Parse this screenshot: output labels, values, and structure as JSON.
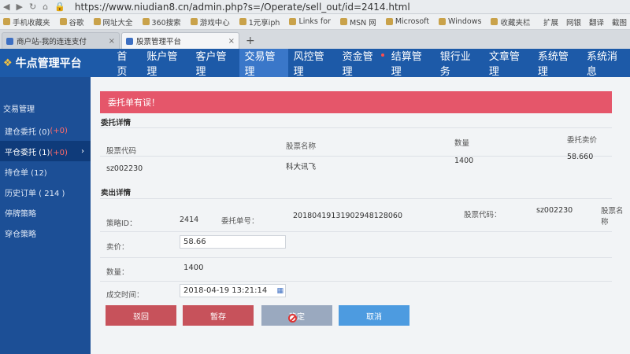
{
  "browser": {
    "url": "https://www.niudian8.cn/admin.php?s=/Operate/sell_out/id=2414.html",
    "bookmarks": [
      "手机收藏夹",
      "谷歌",
      "网址大全",
      "360搜索",
      "游戏中心",
      "1元享iph",
      "Links for",
      "MSN 网",
      "Microsoft",
      "Windows",
      "收藏夹栏"
    ],
    "bookmarks_right": [
      "扩展",
      "网银",
      "翻译",
      "截图"
    ],
    "tabs": [
      {
        "label": "商户站-我的连连支付",
        "active": false
      },
      {
        "label": "股票管理平台",
        "active": true
      }
    ],
    "new_tab": "+"
  },
  "app": {
    "logo": "牛点管理平台",
    "nav": [
      "首页",
      "账户管理",
      "客户管理",
      "交易管理",
      "风控管理",
      "资金管理",
      "结算管理",
      "银行业务",
      "文章管理",
      "系统管理",
      "系统消息"
    ],
    "active_nav": "交易管理"
  },
  "sidebar": {
    "section": "交易管理",
    "items": [
      {
        "label": "建仓委托 (0)",
        "badge": "(+0)"
      },
      {
        "label": "平仓委托 (1)",
        "badge": "(+0)",
        "active": true
      },
      {
        "label": "持仓单 (12)"
      },
      {
        "label": "历史订单 ( 214 )"
      },
      {
        "label": "停牌策略"
      },
      {
        "label": "穿仓策略"
      }
    ]
  },
  "main": {
    "alert": "委托单有误！",
    "entrust_title": "委托详情",
    "entrust": {
      "headers": [
        "股票代码",
        "股票名称",
        "数量",
        "委托卖价"
      ],
      "values": [
        "sz002230",
        "科大讯飞",
        "1400",
        "58.660"
      ]
    },
    "sell_title": "卖出详情",
    "sell": {
      "strategy_label": "策略ID：",
      "strategy_id": "2414",
      "order_label": "委托单号：",
      "order_no": "20180419131902948128060",
      "code_label": "股票代码：",
      "code": "sz002230",
      "name_label": "股票名称",
      "price_label": "卖价：",
      "price": "58.66",
      "qty_label": "数量：",
      "qty": "1400",
      "time_label": "成交时间：",
      "time": "2018-04-19 13:21:14"
    },
    "buttons": {
      "back": "驳回",
      "draft": "暂存",
      "confirm": "确定",
      "cancel": "取消"
    }
  },
  "colors": {
    "header": "#1d5aa8",
    "sidebar": "#1c4f96",
    "alert": "#e5566a",
    "danger_btn": "#c7525b",
    "confirm_btn": "#9aa9bf",
    "cancel_btn": "#4d9be0"
  }
}
